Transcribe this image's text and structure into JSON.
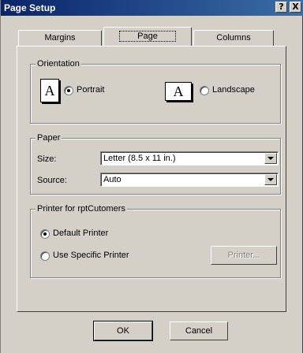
{
  "window": {
    "title": "Page Setup",
    "help_button": "?",
    "close_button": "X"
  },
  "tabs": [
    {
      "label": "Margins",
      "active": false
    },
    {
      "label": "Page",
      "active": true
    },
    {
      "label": "Columns",
      "active": false
    }
  ],
  "orientation": {
    "legend": "Orientation",
    "portrait_label": "Portrait",
    "portrait_icon_letter": "A",
    "landscape_label": "Landscape",
    "landscape_icon_letter": "A",
    "selected": "portrait"
  },
  "paper": {
    "legend": "Paper",
    "size_label": "Size:",
    "size_value": "Letter (8.5 x 11 in.)",
    "source_label": "Source:",
    "source_value": "Auto"
  },
  "printer": {
    "legend": "Printer for rptCutomers",
    "default_label": "Default Printer",
    "specific_label": "Use Specific Printer",
    "printer_button": "Printer...",
    "selected": "default"
  },
  "footer": {
    "ok_label": "OK",
    "cancel_label": "Cancel"
  }
}
